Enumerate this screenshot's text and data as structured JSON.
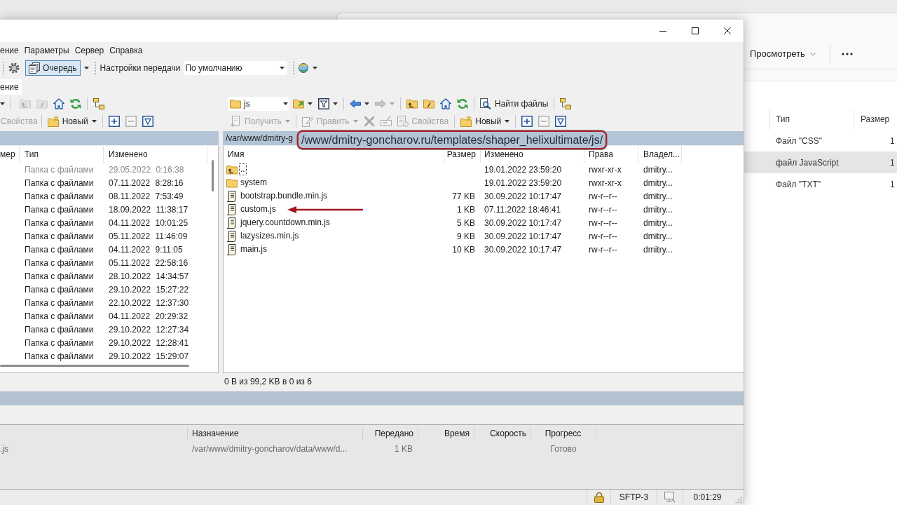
{
  "explorer_window": {
    "toolbar": {
      "view_button": {
        "label": "Просмотреть"
      }
    },
    "columns": [
      "Тип",
      "Размер"
    ],
    "rows": [
      {
        "type": "Файл \"CSS\"",
        "size": "1",
        "selected": false
      },
      {
        "type": "файл JavaScript",
        "size": "1",
        "selected": true
      },
      {
        "type": "Файл \"TXT\"",
        "size": "1",
        "selected": false
      }
    ]
  },
  "main_window": {
    "menu": [
      "ение",
      "Параметры",
      "Сервер",
      "Справка"
    ],
    "toolbar": {
      "queue_button": {
        "label": "Очередь",
        "on": true
      },
      "transfer_settings": {
        "label": "Настройки передачи",
        "value": "По умолчанию"
      }
    },
    "session_tabs": [
      {
        "label": "ение",
        "selected": true
      }
    ],
    "left_panel": {
      "toolbar_top": [
        [
          {
            "kind": "parent",
            "disabled": true
          },
          {
            "kind": "root",
            "disabled": true
          },
          {
            "kind": "home",
            "disabled": false
          },
          {
            "kind": "refresh",
            "disabled": false
          }
        ],
        [
          {
            "kind": "tree",
            "disabled": false
          }
        ]
      ],
      "toolbar_bottom": [
        [
          {
            "kind": "text",
            "label": "Свойства",
            "disabled": true
          }
        ],
        [
          {
            "kind": "new",
            "label": "Новый",
            "disabled": false
          }
        ],
        [
          {
            "kind": "select",
            "disabled": false
          },
          {
            "kind": "unselect",
            "disabled": true
          },
          {
            "kind": "select_all",
            "disabled": false
          }
        ]
      ],
      "columns": [
        "мер",
        "Тип",
        "Изменено"
      ],
      "rows": [
        {
          "type": "Папка с файлами",
          "modified": "29.05.2022 0:16:38",
          "hidden": true
        },
        {
          "type": "Папка с файлами",
          "modified": "07.11.2022 8:28:16",
          "hidden": false
        },
        {
          "type": "Папка с файлами",
          "modified": "08.11.2022 7:53:49",
          "hidden": false
        },
        {
          "type": "Папка с файлами",
          "modified": "18.09.2022 11:38:17",
          "hidden": false
        },
        {
          "type": "Папка с файлами",
          "modified": "04.11.2022 10:01:25",
          "hidden": false
        },
        {
          "type": "Папка с файлами",
          "modified": "05.11.2022 11:46:09",
          "hidden": false
        },
        {
          "type": "Папка с файлами",
          "modified": "04.11.2022 9:11:05",
          "hidden": false
        },
        {
          "type": "Папка с файлами",
          "modified": "05.11.2022 22:58:16",
          "hidden": false
        },
        {
          "type": "Папка с файлами",
          "modified": "28.10.2022 14:34:57",
          "hidden": false
        },
        {
          "type": "Папка с файлами",
          "modified": "29.10.2022 15:27:22",
          "hidden": false
        },
        {
          "type": "Папка с файлами",
          "modified": "22.10.2022 12:37:30",
          "hidden": false
        },
        {
          "type": "Папка с файлами",
          "modified": "04.11.2022 20:29:32",
          "hidden": false
        },
        {
          "type": "Папка с файлами",
          "modified": "29.10.2022 12:27:34",
          "hidden": false
        },
        {
          "type": "Папка с файлами",
          "modified": "29.10.2022 12:28:41",
          "hidden": false
        },
        {
          "type": "Папка с файлами",
          "modified": "29.10.2022 15:29:07",
          "hidden": false
        }
      ]
    },
    "right_panel": {
      "path_box": {
        "value": "js"
      },
      "toolbar_top": [
        [
          {
            "kind": "open",
            "disabled": false
          },
          {
            "kind": "filter",
            "disabled": false
          }
        ],
        [
          {
            "kind": "back",
            "disabled": false
          },
          {
            "kind": "forward",
            "disabled": true
          }
        ],
        [
          {
            "kind": "parent",
            "disabled": false
          },
          {
            "kind": "root",
            "disabled": false
          },
          {
            "kind": "home",
            "disabled": false
          },
          {
            "kind": "refresh",
            "disabled": false
          }
        ],
        [
          {
            "kind": "find",
            "label": "Найти файлы",
            "disabled": false
          }
        ],
        [
          {
            "kind": "tree",
            "disabled": false
          }
        ]
      ],
      "toolbar_bottom": [
        [
          {
            "kind": "get",
            "label": "Получить",
            "disabled": true
          }
        ],
        [
          {
            "kind": "edit",
            "label": "Править",
            "disabled": true
          },
          {
            "kind": "delete",
            "disabled": true
          },
          {
            "kind": "rename",
            "disabled": true
          },
          {
            "kind": "properties",
            "label": "Свойства",
            "disabled": true
          }
        ],
        [
          {
            "kind": "new",
            "label": "Новый",
            "disabled": false
          }
        ],
        [
          {
            "kind": "select",
            "disabled": false
          },
          {
            "kind": "unselect",
            "disabled": true
          },
          {
            "kind": "select_all",
            "disabled": false
          }
        ]
      ],
      "path": "/var/www/dmitry-g",
      "path_callout": "/www/dmitry-goncharov.ru/templates/shaper_helixultimate/js/",
      "columns": [
        "Имя",
        "Размер",
        "Изменено",
        "Права",
        "Владел..."
      ],
      "rows": [
        {
          "kind": "parent",
          "name": "..",
          "modified": "19.01.2022 23:59:20",
          "rights": "rwxr-xr-x",
          "owner": "dmitry...",
          "focused": true,
          "arrow": false
        },
        {
          "kind": "folder",
          "name": "system",
          "modified": "19.01.2022 23:59:20",
          "rights": "rwxr-xr-x",
          "owner": "dmitry...",
          "focused": false,
          "arrow": false
        },
        {
          "kind": "file",
          "name": "bootstrap.bundle.min.js",
          "size": "77 KB",
          "modified": "30.09.2022 10:17:47",
          "rights": "rw-r--r--",
          "owner": "dmitry...",
          "focused": false,
          "arrow": false
        },
        {
          "kind": "file",
          "name": "custom.js",
          "size": "1 KB",
          "modified": "07.11.2022 18:46:41",
          "rights": "rw-r--r--",
          "owner": "dmitry...",
          "focused": false,
          "arrow": true
        },
        {
          "kind": "file",
          "name": "jquery.countdown.min.js",
          "size": "5 KB",
          "modified": "30.09.2022 10:17:47",
          "rights": "rw-r--r--",
          "owner": "dmitry...",
          "focused": false,
          "arrow": false
        },
        {
          "kind": "file",
          "name": "lazysizes.min.js",
          "size": "9 KB",
          "modified": "30.09.2022 10:17:47",
          "rights": "rw-r--r--",
          "owner": "dmitry...",
          "focused": false,
          "arrow": false
        },
        {
          "kind": "file",
          "name": "main.js",
          "size": "10 KB",
          "modified": "30.09.2022 10:17:47",
          "rights": "rw-r--r--",
          "owner": "dmitry...",
          "focused": false,
          "arrow": false
        }
      ],
      "status": "0 B из 99,2 KB в 0 из 6"
    },
    "queue": {
      "columns": [
        "Назначение",
        "Передано",
        "Время",
        "Скорость",
        "Прогресс"
      ],
      "rows": [
        {
          "column_1": ".js",
          "destination": "/var/www/dmitry-goncharov/data/www/d...",
          "transferred": "1 KB",
          "progress": "Готово"
        }
      ]
    },
    "status_bar": {
      "protocol": "SFTP-3",
      "elapsed": "0:01:29"
    }
  }
}
